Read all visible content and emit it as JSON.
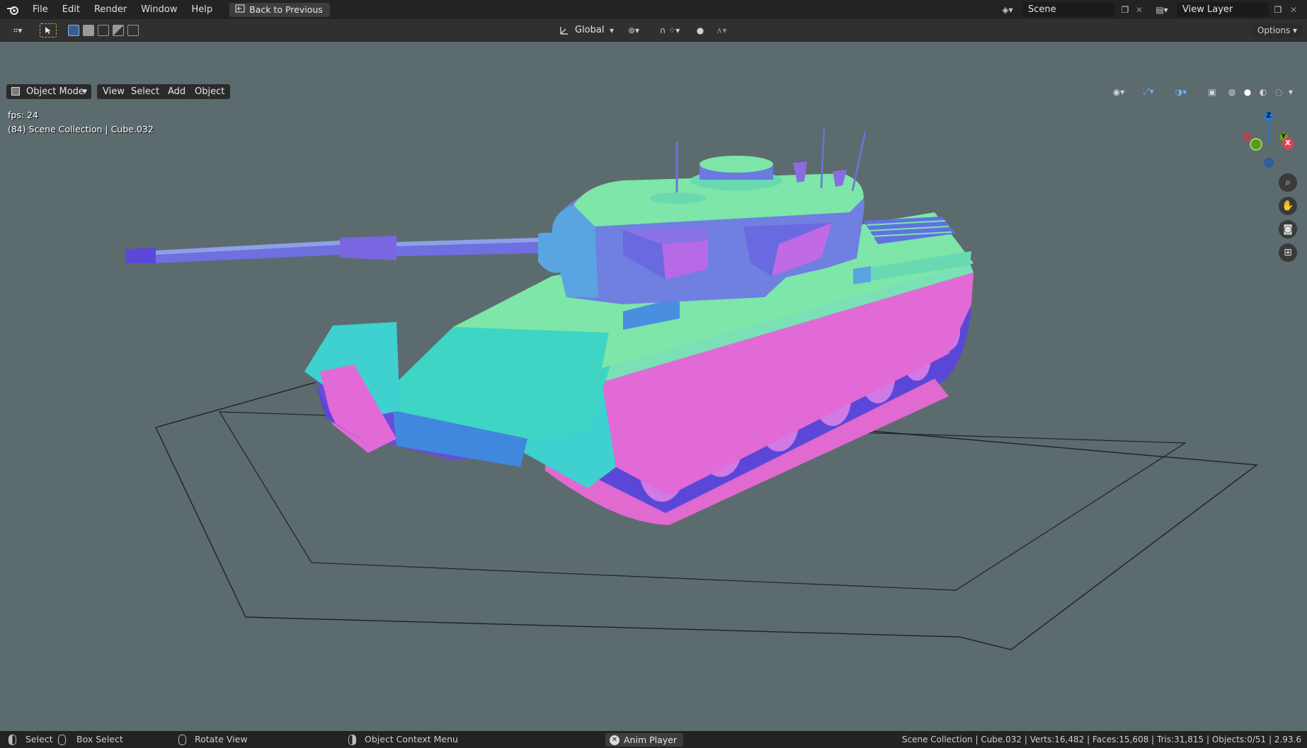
{
  "menu": {
    "items": [
      "File",
      "Edit",
      "Render",
      "Window",
      "Help"
    ],
    "back_button": "Back to Previous"
  },
  "workspace": {
    "scene_name": "Scene",
    "view_layer": "View Layer"
  },
  "toolbar": {
    "transform_orientation": "Global",
    "options_label": "Options"
  },
  "viewport_header": {
    "mode": "Object Mode",
    "view": "View",
    "select": "Select",
    "add": "Add",
    "object": "Object"
  },
  "overlay": {
    "fps": "fps: 24",
    "collection_info": "(84) Scene Collection | Cube.032"
  },
  "gizmo": {
    "z_label": "Z",
    "y_label": "Y",
    "x_label": "X",
    "colors": {
      "x": "#e53d52",
      "y": "#6c9a28",
      "z": "#2e76c8"
    }
  },
  "statusbar": {
    "select": "Select",
    "box_select": "Box Select",
    "rotate_view": "Rotate View",
    "context_menu": "Object Context Menu",
    "anim_player": "Anim Player",
    "stats": "Scene Collection | Cube.032 | Verts:16,482 | Faces:15,608 | Tris:31,815 | Objects:0/51 | 2.93.6"
  },
  "icons": {
    "blender_logo": "blender-logo-icon",
    "back": "back-arrow-icon",
    "zoom": "zoom-icon",
    "pan": "hand-icon",
    "camera": "camera-icon",
    "ortho": "grid-icon"
  }
}
